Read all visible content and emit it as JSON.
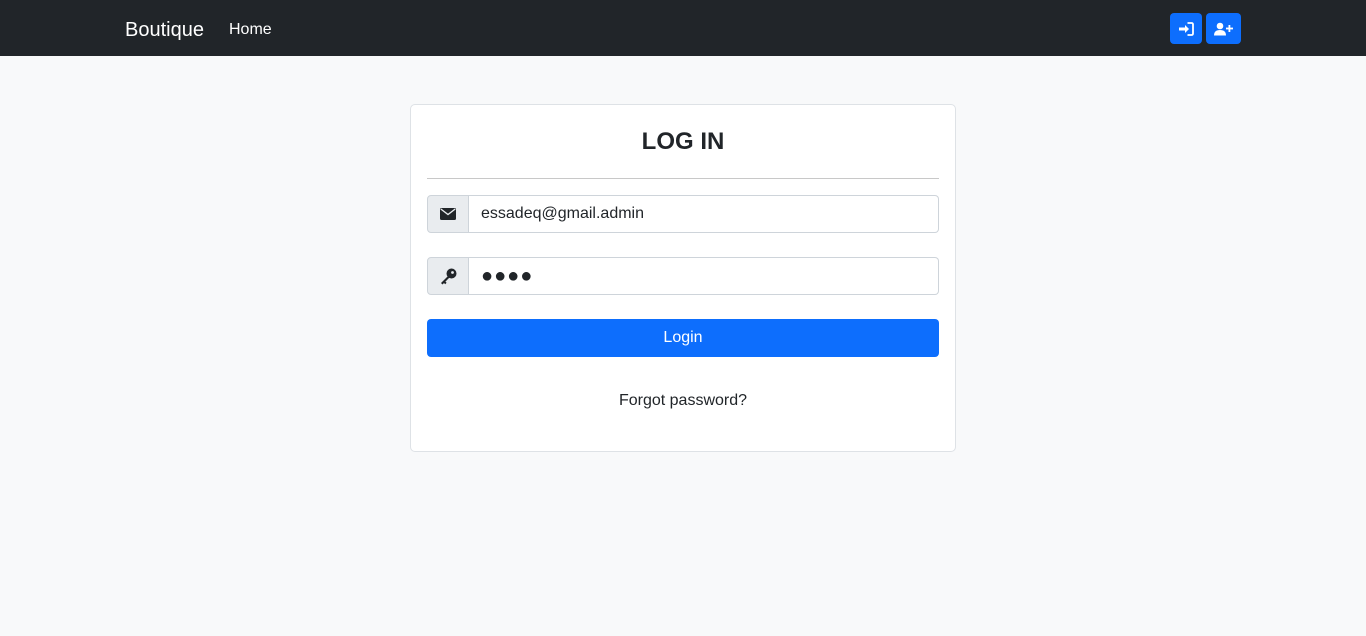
{
  "navbar": {
    "brand": "Boutique",
    "links": [
      {
        "label": "Home"
      }
    ],
    "actions": [
      {
        "icon": "sign-in-icon",
        "color": "#0d6efd"
      },
      {
        "icon": "user-plus-icon",
        "color": "#0d6efd"
      }
    ]
  },
  "login_card": {
    "title": "LOG IN",
    "email": {
      "icon": "envelope-icon",
      "value": "essadeq@gmail.admin"
    },
    "password": {
      "icon": "key-icon",
      "value": "●●●●"
    },
    "submit_label": "Login",
    "forgot_label": "Forgot password?"
  },
  "colors": {
    "navbar_bg": "#212529",
    "primary": "#0d6efd",
    "page_bg": "#f8f9fa"
  }
}
